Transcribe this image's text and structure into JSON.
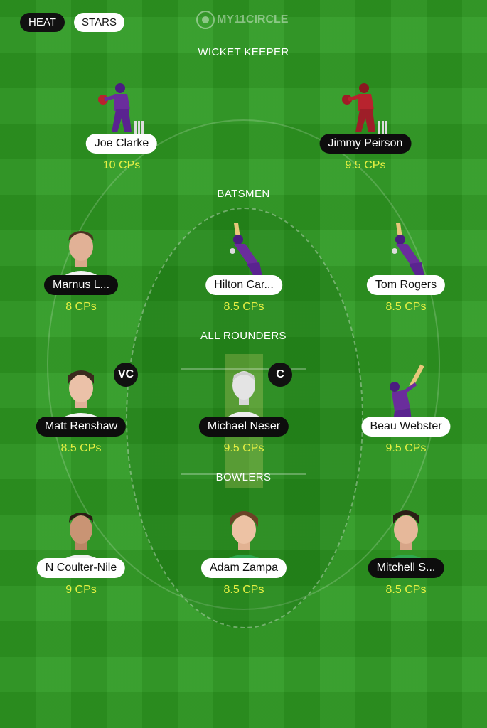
{
  "toggle": {
    "heat_label": "HEAT",
    "stars_label": "STARS"
  },
  "brand": {
    "logo_text": "MY11CIRCLE"
  },
  "sections": {
    "wicket_keeper": "WICKET KEEPER",
    "batsmen": "BATSMEN",
    "all_rounders": "ALL ROUNDERS",
    "bowlers": "BOWLERS"
  },
  "players": {
    "joe_clarke": {
      "name": "Joe Clarke",
      "cps": "10 CPs",
      "avatar": "wicketkeeper-purple-icon"
    },
    "jimmy_peirson": {
      "name": "Jimmy Peirson",
      "cps": "9.5 CPs",
      "avatar": "wicketkeeper-red-icon"
    },
    "marnus": {
      "name": "Marnus L...",
      "cps": "8 CPs",
      "avatar": "player-photo"
    },
    "hilton": {
      "name": "Hilton Car...",
      "cps": "8.5 CPs",
      "avatar": "batsman-purple-icon"
    },
    "tom_rogers": {
      "name": "Tom Rogers",
      "cps": "8.5 CPs",
      "avatar": "batsman-purple-icon"
    },
    "matt_renshaw": {
      "name": "Matt Renshaw",
      "cps": "8.5 CPs",
      "avatar": "player-photo",
      "badge": "VC"
    },
    "michael_neser": {
      "name": "Michael Neser",
      "cps": "9.5 CPs",
      "avatar": "placeholder-silhouette-icon",
      "badge": "C"
    },
    "beau_webster": {
      "name": "Beau Webster",
      "cps": "9.5 CPs",
      "avatar": "batsman-swing-icon"
    },
    "coulter_nile": {
      "name": "N Coulter-Nile",
      "cps": "9 CPs",
      "avatar": "player-photo"
    },
    "adam_zampa": {
      "name": "Adam Zampa",
      "cps": "8.5 CPs",
      "avatar": "player-photo"
    },
    "mitchell": {
      "name": "Mitchell S...",
      "cps": "8.5 CPs",
      "avatar": "player-photo"
    }
  },
  "colors": {
    "field": "#2e9a22",
    "cps_text": "#e7f043",
    "purple_kit": "#6a2d9c",
    "red_kit": "#b8232e"
  }
}
